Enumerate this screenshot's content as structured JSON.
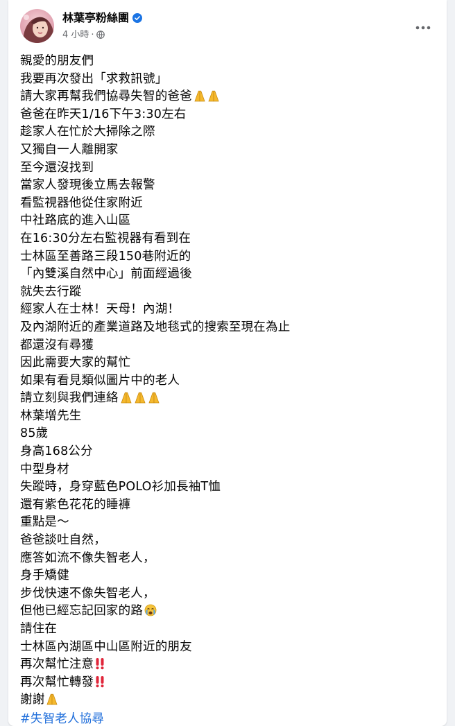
{
  "post": {
    "author": "林葉亭粉絲團",
    "time": "4 小時",
    "separator": "·",
    "icons": {
      "verified": "verified-badge-icon",
      "audience": "globe-icon",
      "more": "more-options-icon"
    },
    "colors": {
      "text": "#050505",
      "meta": "#65676b",
      "verified": "#1b74e4",
      "hashtag": "#216fdb",
      "background": "#f0f2f5"
    },
    "lines": [
      "親愛的朋友們",
      "我要再次發出「求救訊號」",
      "請大家再幫我們協尋失智的爸爸",
      "爸爸在昨天1/16下午3:30左右",
      "趁家人在忙於大掃除之際",
      "又獨自一人離開家",
      "至今還沒找到",
      "當家人發現後立馬去報警",
      "看監視器他從住家附近",
      "中社路底的進入山區",
      "在16:30分左右監視器有看到在",
      "士林區至善路三段150巷附近的",
      "「內雙溪自然中心」前面經過後",
      "就失去行蹤",
      "經家人在士林！天母！內湖！",
      "及內湖附近的產業道路及地毯式的搜索至現在為止",
      "都還沒有尋獲",
      "因此需要大家的幫忙",
      "如果有看見類似圖片中的老人",
      "請立刻與我們連絡",
      "林葉增先生",
      "85歲",
      "身高168公分",
      "中型身材",
      "失蹤時，身穿藍色POLO衫加長袖T恤",
      "還有紫色花花的睡褲",
      "重點是～",
      "爸爸談吐自然，",
      "應答如流不像失智老人，",
      "身手矯健",
      "步伐快速不像失智老人，",
      "但他已經忘記回家的路",
      "請住在",
      "士林區內湖區中山區附近的朋友",
      "再次幫忙注意",
      "再次幫忙轉發",
      "謝謝"
    ],
    "emojis": {
      "2": "folded-hands-icon x2",
      "19": "folded-hands-icon x3",
      "31": "crying-face-icon",
      "34": "double-exclamation-icon",
      "35": "double-exclamation-icon",
      "36": "folded-hands-icon"
    },
    "hashtag": "#失智老人協尋"
  }
}
